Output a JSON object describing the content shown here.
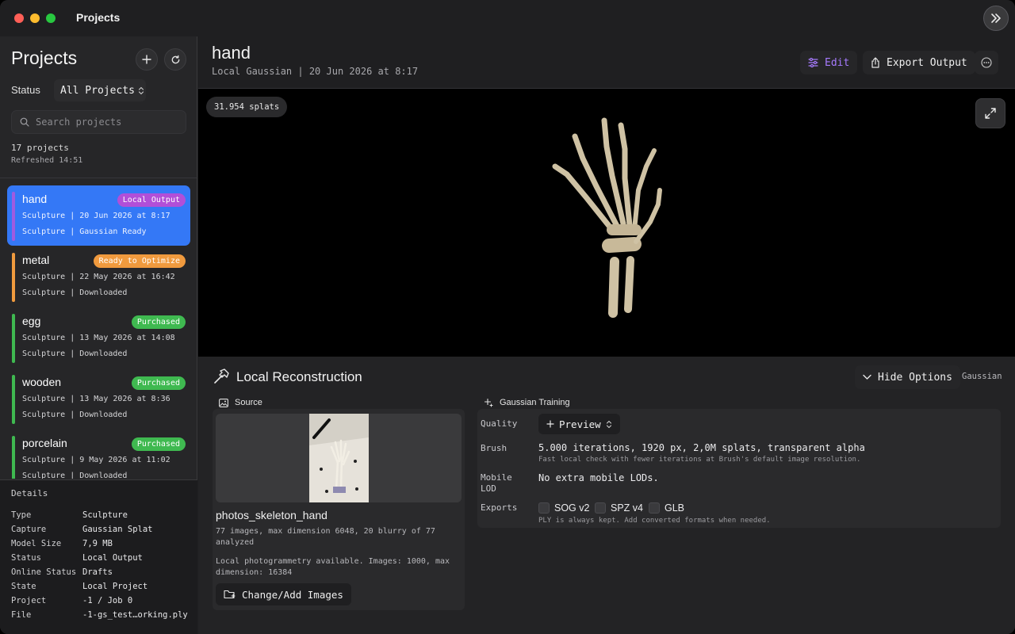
{
  "window": {
    "title": "Projects"
  },
  "sidebar": {
    "heading": "Projects",
    "status_label": "Status",
    "status_value": "All Projects",
    "search_placeholder": "Search projects",
    "count": "17 projects",
    "refreshed": "Refreshed 14:51",
    "projects": [
      {
        "name": "hand",
        "badge": "Local Output",
        "badge_color": "#b14fd8",
        "bar_color": "#a05be0",
        "line1": "Sculpture | 20 Jun 2026 at 8:17",
        "line2": "Sculpture | Gaussian Ready",
        "selected": true
      },
      {
        "name": "metal",
        "badge": "Ready to Optimize",
        "badge_color": "#f09a3e",
        "bar_color": "#f09a3e",
        "line1": "Sculpture | 22 May 2026 at 16:42",
        "line2": "Sculpture | Downloaded"
      },
      {
        "name": "egg",
        "badge": "Purchased",
        "badge_color": "#3fb950",
        "bar_color": "#3fb950",
        "line1": "Sculpture | 13 May 2026 at 14:08",
        "line2": "Sculpture | Downloaded"
      },
      {
        "name": "wooden",
        "badge": "Purchased",
        "badge_color": "#3fb950",
        "bar_color": "#3fb950",
        "line1": "Sculpture | 13 May 2026 at 8:36",
        "line2": "Sculpture | Downloaded"
      },
      {
        "name": "porcelain",
        "badge": "Purchased",
        "badge_color": "#3fb950",
        "bar_color": "#3fb950",
        "line1": "Sculpture | 9 May 2026 at 11:02",
        "line2": "Sculpture | Downloaded"
      }
    ],
    "details": {
      "title": "Details",
      "rows": [
        {
          "k": "Type",
          "v": "Sculpture"
        },
        {
          "k": "Capture",
          "v": "Gaussian Splat"
        },
        {
          "k": "Model Size",
          "v": "7,9 MB"
        },
        {
          "k": "Status",
          "v": "Local Output"
        },
        {
          "k": "Online Status",
          "v": "Drafts"
        },
        {
          "k": "State",
          "v": "Local Project"
        },
        {
          "k": "Project",
          "v": "-1 / Job 0"
        },
        {
          "k": "File",
          "v": "-1-gs_test…orking.ply"
        }
      ]
    }
  },
  "main": {
    "title": "hand",
    "subtitle": "Local Gaussian | 20 Jun 2026 at 8:17",
    "edit_label": "Edit",
    "export_label": "Export Output",
    "splats": "31.954 splats",
    "recon": {
      "title": "Local Reconstruction",
      "hide_label": "Hide Options",
      "mode_label": "Gaussian",
      "source": {
        "head": "Source",
        "name": "photos_skeleton_hand",
        "meta1": "77 images, max dimension 6048, 20 blurry of 77 analyzed",
        "meta2": "Local photogrammetry available. Images: 1000, max dimension: 16384",
        "change_label": "Change/Add Images"
      },
      "training": {
        "head": "Gaussian Training",
        "quality_label": "Quality",
        "quality_value": "Preview",
        "brush_label": "Brush",
        "brush_value": "5.000 iterations, 1920 px, 2,0M splats, transparent alpha",
        "brush_sub": "Fast local check with fewer iterations at Brush's default image resolution.",
        "mobile_label": "Mobile LOD",
        "mobile_value": "No extra mobile LODs.",
        "exports_label": "Exports",
        "exports": [
          "SOG v2",
          "SPZ v4",
          "GLB"
        ],
        "exports_sub": "PLY is always kept. Add converted formats when needed."
      }
    }
  },
  "colors": {
    "accent": "#3478f6",
    "edit": "#a77bff"
  }
}
